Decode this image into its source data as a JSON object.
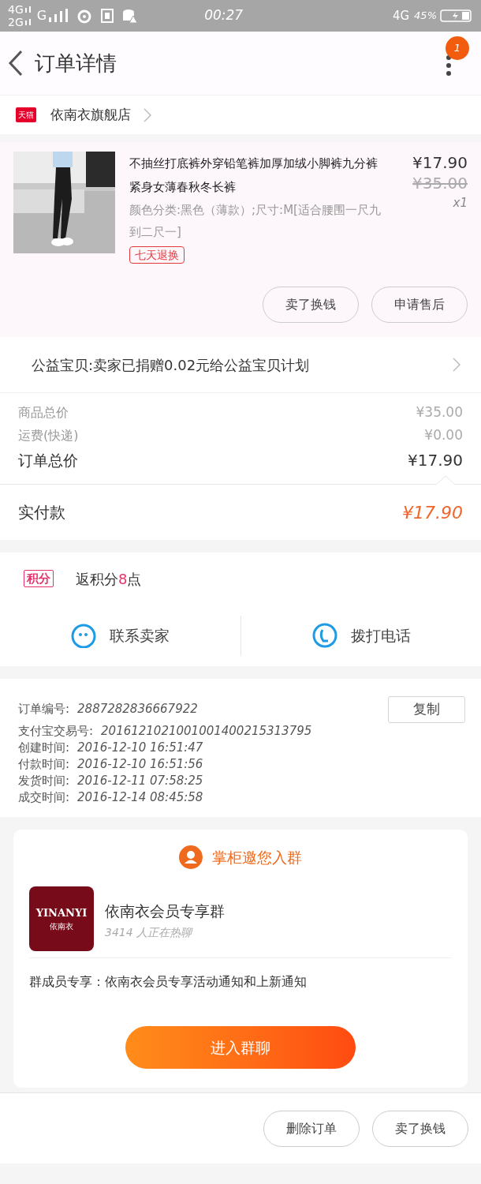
{
  "status_bar": {
    "network_1": "4G",
    "network_2": "2G",
    "network_3": "G",
    "time": "00:27",
    "network_4": "4G",
    "battery": "45%"
  },
  "header": {
    "title": "订单详情",
    "badge": "1"
  },
  "store": {
    "badge": "天猫",
    "name": "依南衣旗舰店"
  },
  "product": {
    "title": "不抽丝打底裤外穿铅笔裤加厚加绒小脚裤九分裤紧身女薄春秋冬长裤",
    "spec": "颜色分类:黑色（薄款）;尺寸:M[适合腰围一尺九到二尺一]",
    "tag": "七天退换",
    "price": "¥17.90",
    "original_price": "¥35.00",
    "quantity": "x1",
    "buttons": [
      "卖了换钱",
      "申请售后"
    ]
  },
  "charity": {
    "text": "公益宝贝:卖家已捐赠0.02元给公益宝贝计划"
  },
  "price_summary": {
    "rows": [
      {
        "kind": "minor",
        "label": "商品总价",
        "value": "¥35.00"
      },
      {
        "kind": "minor",
        "label": "运费(快递)",
        "value": "¥0.00"
      },
      {
        "kind": "total",
        "label": "订单总价",
        "value": "¥17.90"
      }
    ],
    "paid_label": "实付款",
    "paid_value": "¥17.90"
  },
  "points": {
    "badge": "积分",
    "text_before": "返积分",
    "amount": "8",
    "text_after": "点"
  },
  "contact": [
    {
      "kind": "chat",
      "label": "联系卖家"
    },
    {
      "kind": "phone",
      "label": "拨打电话"
    }
  ],
  "order_info": {
    "copy_button": "复制",
    "rows": [
      {
        "label": "订单编号:",
        "value": "2887282836667922"
      },
      {
        "label": "支付宝交易号:",
        "value": "2016121021001001400215313795"
      },
      {
        "label": "创建时间:",
        "value": "2016-12-10 16:51:47"
      },
      {
        "label": "付款时间:",
        "value": "2016-12-10 16:51:56"
      },
      {
        "label": "发货时间:",
        "value": "2016-12-11 07:58:25"
      },
      {
        "label": "成交时间:",
        "value": "2016-12-14 08:45:58"
      }
    ]
  },
  "group_invite": {
    "heading": "掌柜邀您入群",
    "logo": "YINANYI",
    "logo_sub": "依南衣",
    "name": "依南衣会员专享群",
    "members": "3414 人正在热聊",
    "description": "群成员专享：依南衣会员专享活动通知和上新通知",
    "join_button": "进入群聊"
  },
  "bottom_bar": {
    "buttons": [
      "删除订单",
      "卖了换钱"
    ]
  }
}
